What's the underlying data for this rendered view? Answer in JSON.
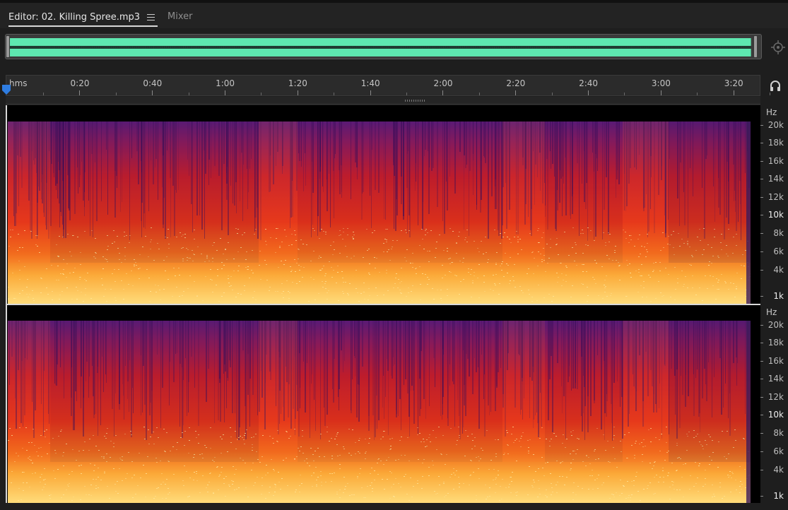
{
  "tabs": {
    "editor_label": "Editor: 02. Killing Spree.mp3",
    "mixer_label": "Mixer"
  },
  "icons": {
    "panel_menu": "hamburger-menu-icon",
    "zoom_target": "crosshair-zoom-icon",
    "headphones": "headphones-icon",
    "playhead": "playhead-marker-icon"
  },
  "colors": {
    "waveform": "#5ee8b0",
    "playhead": "#2f7de1",
    "spectrum_high": "#ffd36a",
    "spectrum_mid": "#e23a14",
    "spectrum_low": "#6a1a78"
  },
  "ruler": {
    "unit": "hms",
    "ticks": [
      "0:20",
      "0:40",
      "1:00",
      "1:20",
      "1:40",
      "2:00",
      "2:20",
      "2:40",
      "3:00",
      "3:20"
    ]
  },
  "frequency_scale": {
    "unit": "Hz",
    "labels": [
      "20k",
      "18k",
      "16k",
      "14k",
      "12k",
      "10k",
      "8k",
      "6k",
      "4k",
      "1k"
    ],
    "bold_labels": [
      "10k",
      "1k"
    ]
  },
  "channel1_scale": {
    "unit": "Hz"
  },
  "channel2_scale": {
    "unit": "Hz"
  }
}
